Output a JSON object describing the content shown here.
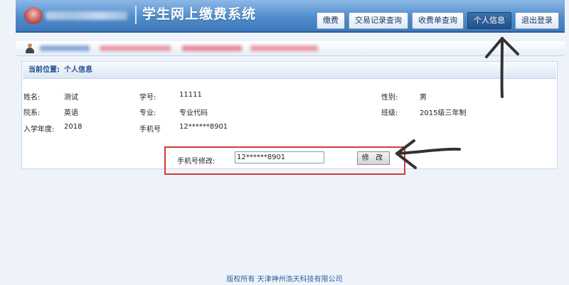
{
  "header": {
    "title": "学生网上缴费系统",
    "nav": [
      "缴费",
      "交易记录查询",
      "收费单查询",
      "个人信息",
      "退出登录"
    ],
    "active_index": 3
  },
  "breadcrumb": {
    "label": "当前位置:",
    "value": "个人信息"
  },
  "info": {
    "name_label": "姓名:",
    "name": "测试",
    "id_label": "学号:",
    "id": "11111",
    "gender_label": "性别:",
    "gender": "男",
    "dept_label": "院系:",
    "dept": "英语",
    "major_label": "专业:",
    "major": "专业代码",
    "class_label": "班级:",
    "class": "2015级三年制",
    "year_label": "入学年度:",
    "year": "2018",
    "phone_label": "手机号",
    "phone": "12******8901"
  },
  "modify": {
    "label": "手机号修改:",
    "input_value": "12******8901",
    "button": "修 改"
  },
  "footer": "版权所有 天津神州浩天科技有限公司",
  "colors": {
    "header": "#4f8ccc",
    "highlight": "#d23a3a",
    "active_nav": "#22508a"
  }
}
